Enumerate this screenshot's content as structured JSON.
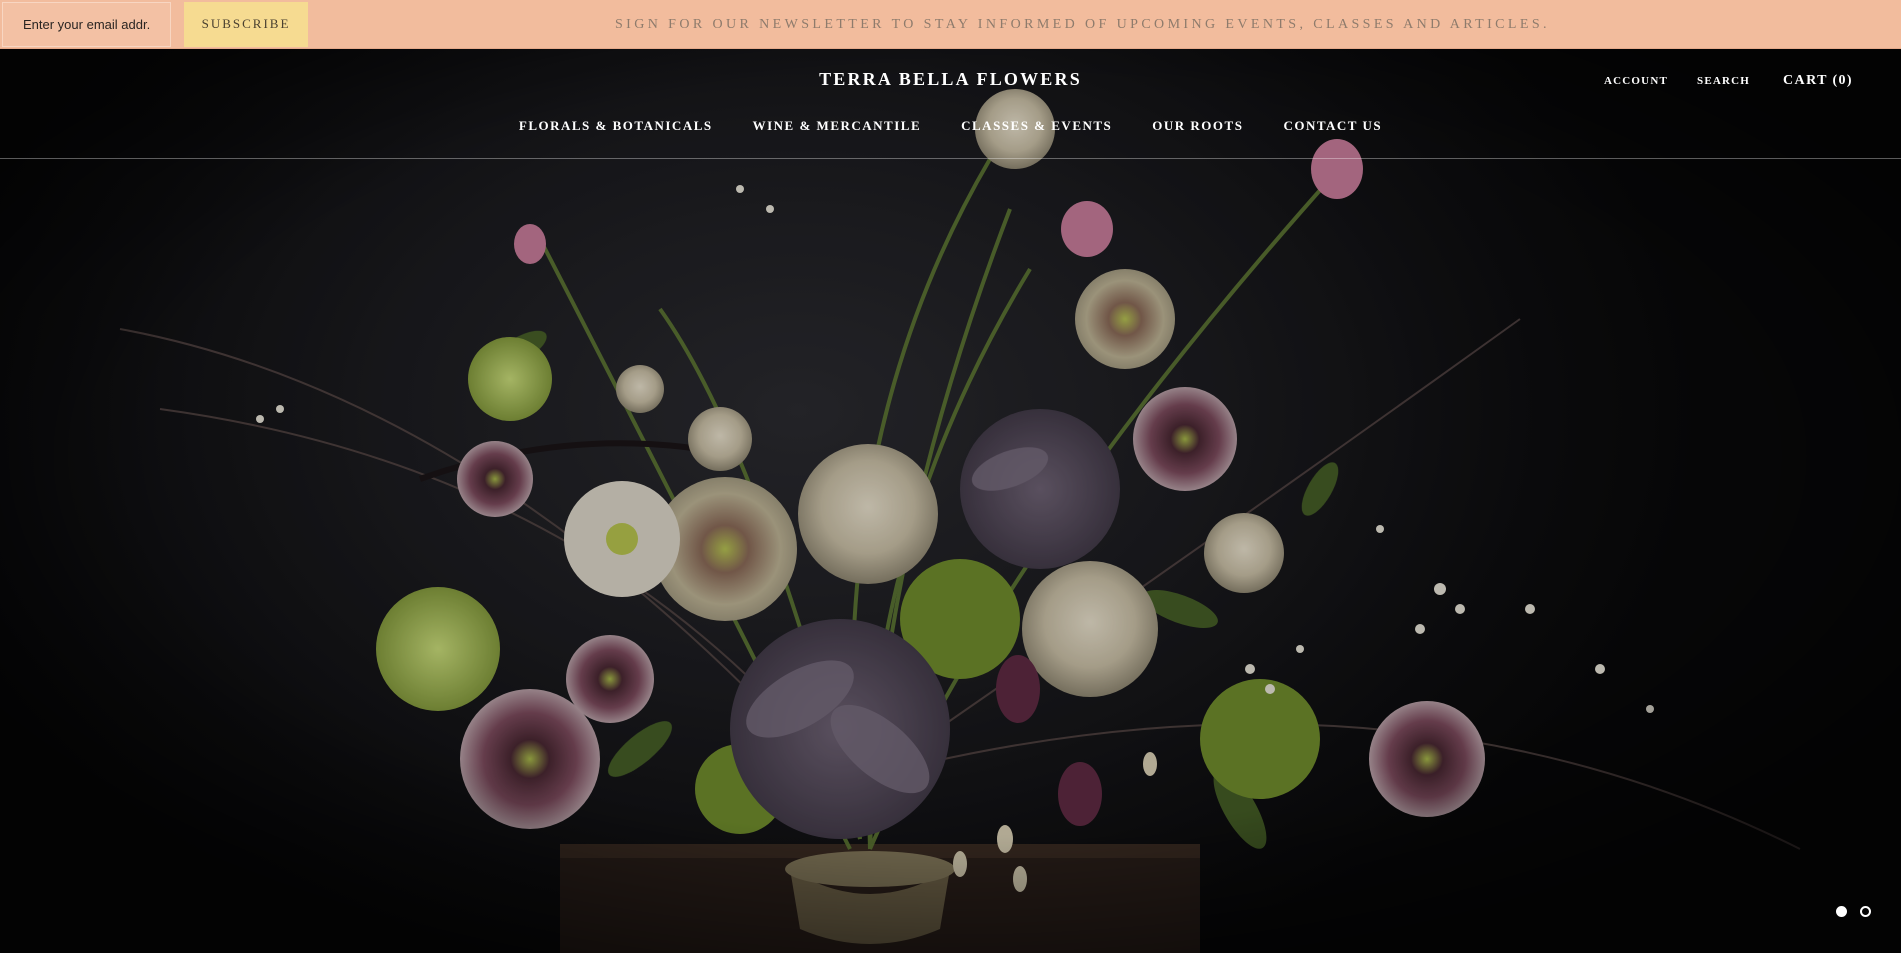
{
  "newsletter": {
    "email_placeholder": "Enter your email addr...",
    "subscribe_label": "SUBSCRIBE",
    "message": "SIGN FOR OUR NEWSLETTER TO STAY INFORMED OF UPCOMING EVENTS, CLASSES AND ARTICLES."
  },
  "header": {
    "logo": "TERRA BELLA FLOWERS",
    "account_label": "ACCOUNT",
    "search_label": "SEARCH",
    "cart_label": "CART (0)"
  },
  "nav": {
    "items": [
      "FLORALS & BOTANICALS",
      "WINE & MERCANTILE",
      "CLASSES & EVENTS",
      "OUR ROOTS",
      "CONTACT US"
    ]
  },
  "slideshow": {
    "slide_count": 2,
    "active_slide": 1
  },
  "colors": {
    "newsletter_bg": "#f2bc9d",
    "subscribe_bg": "#f6db91",
    "hero_bg": "#0d0d0e",
    "header_text": "#ffffff"
  }
}
